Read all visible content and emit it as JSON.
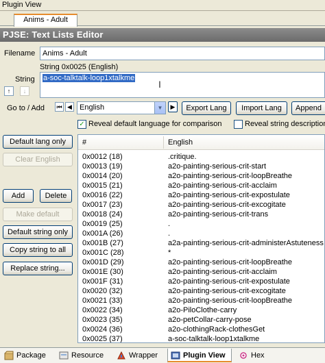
{
  "window": {
    "title": "Plugin View"
  },
  "top_tab": {
    "label": "Anims - Adult"
  },
  "header": {
    "title": "PJSE: Text Lists Editor"
  },
  "filename": {
    "label": "Filename",
    "value": "Anims - Adult"
  },
  "string": {
    "label": "String",
    "caption": "String 0x0025 (English)",
    "value": "a-soc-talktalk-loop1xtalkme"
  },
  "goto": {
    "label": "Go to / Add",
    "language": "English",
    "export_label": "Export Lang",
    "import_label": "Import Lang",
    "append_label": "Append"
  },
  "options": {
    "reveal_default": {
      "label": "Reveal default language for comparison",
      "checked": true
    },
    "reveal_desc": {
      "label": "Reveal string description",
      "checked": false
    }
  },
  "side_buttons": {
    "default_lang_only": "Default lang only",
    "clear_english": "Clear English",
    "add": "Add",
    "delete": "Delete",
    "make_default": "Make default",
    "default_string_only": "Default string only",
    "copy_string_to_all": "Copy string to all",
    "replace_string": "Replace string..."
  },
  "list": {
    "columns": [
      "#",
      "English"
    ],
    "rows": [
      [
        "0x0012 (18)",
        ".critique."
      ],
      [
        "0x0013 (19)",
        "a2o-painting-serious-crit-start"
      ],
      [
        "0x0014 (20)",
        "a2o-painting-serious-crit-loopBreathe"
      ],
      [
        "0x0015 (21)",
        "a2o-painting-serious-crit-acclaim"
      ],
      [
        "0x0016 (22)",
        "a2o-painting-serious-crit-expostulate"
      ],
      [
        "0x0017 (23)",
        "a2o-painting-serious-crit-excogitate"
      ],
      [
        "0x0018 (24)",
        "a2o-painting-serious-crit-trans"
      ],
      [
        "0x0019 (25)",
        "."
      ],
      [
        "0x001A (26)",
        "."
      ],
      [
        "0x001B (27)",
        "a2a-painting-serious-crit-administerAstuteness"
      ],
      [
        "0x001C (28)",
        "*"
      ],
      [
        "0x001D (29)",
        "a2o-painting-serious-crit-loopBreathe"
      ],
      [
        "0x001E (30)",
        "a2o-painting-serious-crit-acclaim"
      ],
      [
        "0x001F (31)",
        "a2o-painting-serious-crit-expostulate"
      ],
      [
        "0x0020 (32)",
        "a2o-painting-serious-crit-excogitate"
      ],
      [
        "0x0021 (33)",
        "a2o-painting-serious-crit-loopBreathe"
      ],
      [
        "0x0022 (34)",
        "a2o-PiloClothe-carry"
      ],
      [
        "0x0023 (35)",
        "a2o-petCollar-carry-pose"
      ],
      [
        "0x0024 (36)",
        "a2o-clothingRack-clothesGet"
      ],
      [
        "0x0025 (37)",
        "a-soc-talktalk-loop1xtalkme"
      ]
    ],
    "selected_index": 19
  },
  "bottom_tabs": [
    {
      "label": "Package",
      "icon": "package-icon"
    },
    {
      "label": "Resource",
      "icon": "resource-icon"
    },
    {
      "label": "Wrapper",
      "icon": "wrapper-icon"
    },
    {
      "label": "Plugin View",
      "icon": "plugin-view-icon",
      "active": true
    },
    {
      "label": "Hex",
      "icon": "hex-icon"
    }
  ],
  "colors": {
    "accent": "#e68b2c",
    "selection": "#316ac5",
    "underline": "#e00000"
  }
}
